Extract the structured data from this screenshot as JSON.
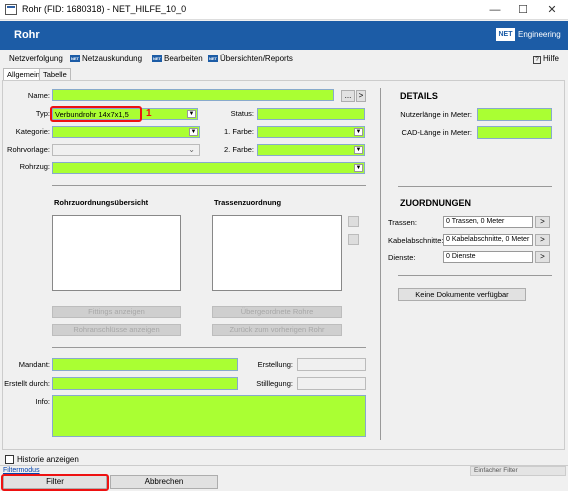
{
  "window": {
    "title": "Rohr (FID: 1680318)  -  NET_HILFE_10_0",
    "minimize": "—",
    "maximize": "☐",
    "close": "✕"
  },
  "header": {
    "title": "Rohr",
    "logo": "NET",
    "brand": "Engineering"
  },
  "menu": {
    "items": [
      "Netzverfolgung",
      "Netzauskundung",
      "Bearbeiten",
      "Übersichten/Reports"
    ],
    "help": "Hilfe"
  },
  "tabs": [
    "Allgemein",
    "Tabelle"
  ],
  "form": {
    "name_label": "Name:",
    "name_value": "",
    "typ_label": "Typ:",
    "typ_value": "Verbundrohr 14x7x1,5",
    "typ_annotation": "1",
    "status_label": "Status:",
    "kategorie_label": "Kategorie:",
    "farbe1_label": "1. Farbe:",
    "rohrvorlage_label": "Rohrvorlage:",
    "farbe2_label": "2. Farbe:",
    "rohrzug_label": "Rohrzug:",
    "more_btn": "...",
    "arrow_btn": ">"
  },
  "lists": {
    "left_title": "Rohrzuordnungsübersicht",
    "right_title": "Trassenzuordnung",
    "btn_fittings": "Fittings anzeigen",
    "btn_anschluesse": "Rohranschlüsse anzeigen",
    "btn_uebergeordnete": "Übergeordnete Rohre",
    "btn_zurueck": "Zurück zum vorherigen Rohr"
  },
  "bottom": {
    "mandant_label": "Mandant:",
    "erstellt_label": "Erstellt durch:",
    "info_label": "Info:",
    "erstellung_label": "Erstellung:",
    "stilllegung_label": "Stilllegung:"
  },
  "details": {
    "title": "DETAILS",
    "nutzer_label": "Nutzerlänge in Meter:",
    "cad_label": "CAD-Länge in Meter:"
  },
  "zuordnungen": {
    "title": "ZUORDNUNGEN",
    "trassen_label": "Trassen:",
    "trassen_value": "0 Trassen, 0 Meter",
    "kabel_label": "Kabelabschnitte:",
    "kabel_value": "0 Kabelabschnitte, 0 Meter",
    "dienste_label": "Dienste:",
    "dienste_value": "0 Dienste",
    "arrow": ">",
    "no_docs": "Keine Dokumente verfügbar"
  },
  "footer": {
    "historie": "Historie anzeigen",
    "filtermodus": "Filtermodus",
    "filter_select": "Einfacher Filter",
    "filter_btn": "Filter",
    "abbrechen_btn": "Abbrechen"
  },
  "colors": {
    "header": "#1c5ca6",
    "field": "#aaff33",
    "highlight": "#e11111"
  }
}
